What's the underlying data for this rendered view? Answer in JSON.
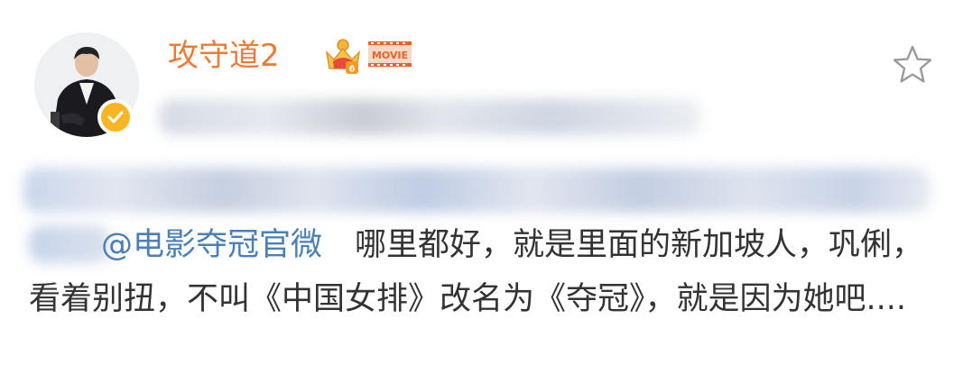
{
  "post": {
    "username": "攻守道2",
    "mention": "@电影夺冠官微",
    "text_first": "哪里都好，就是里面的新加坡人，巩俐，看着别扭，不叫《中国女排》改名为《夺冠》，就是因为她吧....",
    "badges": {
      "crown": "crown-level-badge-icon",
      "movie": "MOVIE"
    },
    "verified_icon": "verified-check-icon",
    "favorite_icon": "star-outline-icon"
  },
  "colors": {
    "username": "#ef7a35",
    "mention": "#4a7fb8",
    "text": "#333333",
    "verified": "#f8b524",
    "movie_badge": "#e8632c"
  }
}
